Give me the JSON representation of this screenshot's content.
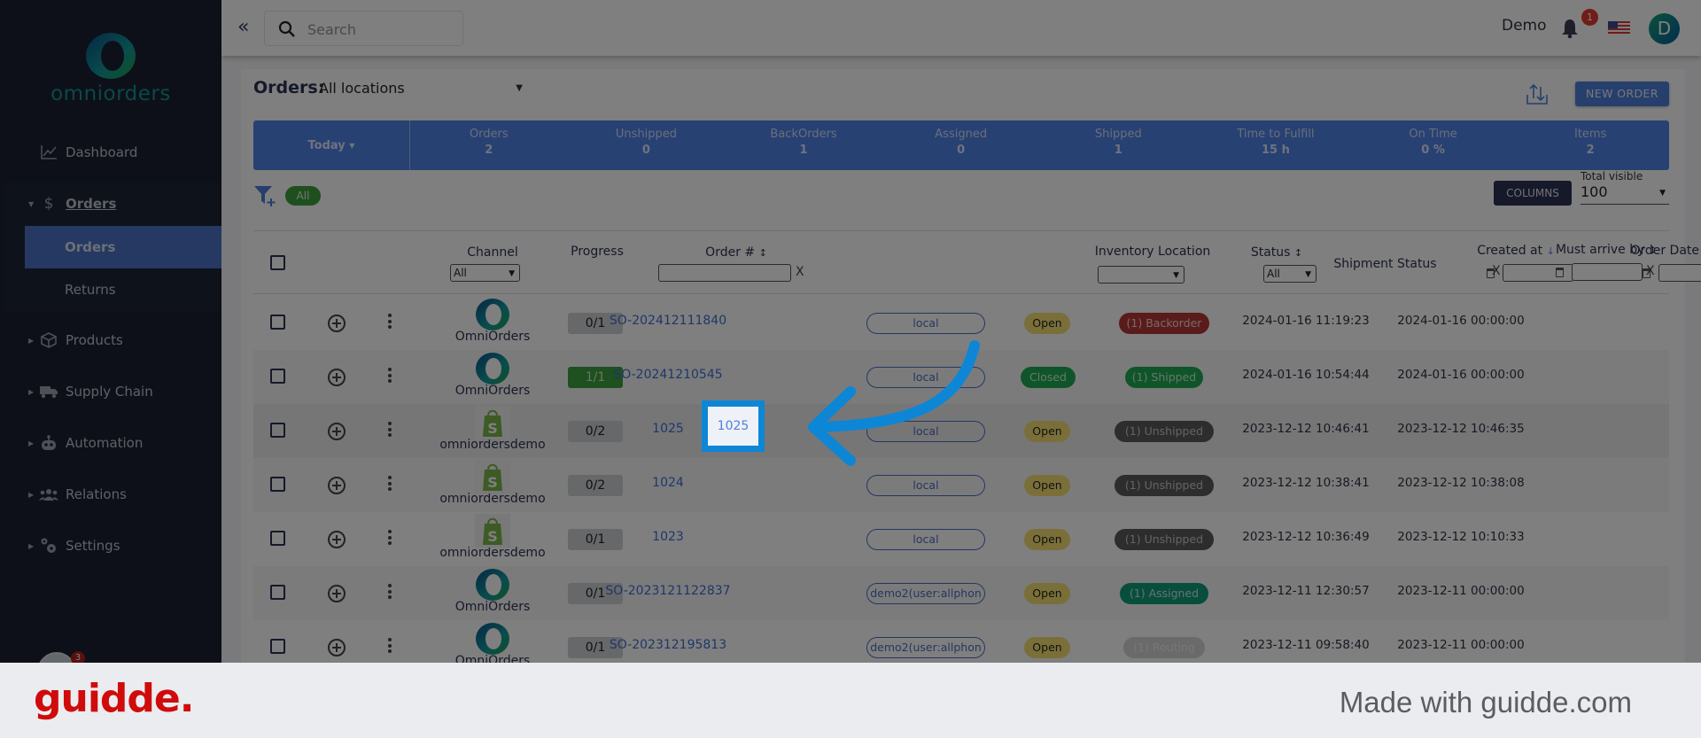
{
  "brand": {
    "name": "omniorders"
  },
  "sidebar": {
    "items": [
      {
        "label": "Dashboard",
        "icon": "chart-line-icon"
      },
      {
        "label": "Orders",
        "icon": "dollar-icon",
        "expanded": true,
        "children": [
          {
            "label": "Orders",
            "active": true
          },
          {
            "label": "Returns"
          }
        ]
      },
      {
        "label": "Products",
        "icon": "box-icon"
      },
      {
        "label": "Supply Chain",
        "icon": "truck-icon"
      },
      {
        "label": "Automation",
        "icon": "robot-icon"
      },
      {
        "label": "Relations",
        "icon": "users-icon"
      },
      {
        "label": "Settings",
        "icon": "gears-icon"
      }
    ],
    "avatar_badge": "3"
  },
  "topbar": {
    "search_placeholder": "Search",
    "user_name": "Demo",
    "notification_count": "1",
    "avatar_initial": "D"
  },
  "page": {
    "title": "Orders:",
    "location": "All locations",
    "new_order_label": "NEW ORDER"
  },
  "stats": {
    "period": "Today",
    "items": [
      {
        "label": "Orders",
        "value": "2"
      },
      {
        "label": "Unshipped",
        "value": "0"
      },
      {
        "label": "BackOrders",
        "value": "1"
      },
      {
        "label": "Assigned",
        "value": "0"
      },
      {
        "label": "Shipped",
        "value": "1"
      },
      {
        "label": "Time to Fulfill",
        "value": "15 h"
      },
      {
        "label": "On Time",
        "value": "0 %"
      },
      {
        "label": "Items",
        "value": "2"
      }
    ]
  },
  "filters": {
    "chip": "All",
    "columns_label": "COLUMNS",
    "total_visible_label": "Total visible",
    "total_visible_value": "100"
  },
  "table": {
    "headers": {
      "channel": "Channel",
      "channel_filter": "All",
      "progress": "Progress",
      "order_no": "Order #",
      "inventory_location": "Inventory Location",
      "status": "Status",
      "status_filter": "All",
      "shipment_status": "Shipment Status",
      "created_at": "Created at",
      "order_date": "Order Date",
      "must_arrive_by": "Must arrive by",
      "clear": "X"
    },
    "rows": [
      {
        "channel": "OmniOrders",
        "channel_type": "omni",
        "progress": "0/1",
        "progress_done": false,
        "order": "SO-202412111840",
        "location": "local",
        "status": "Open",
        "shipment": "(1) Backorder",
        "shipment_type": "backorder",
        "created": "2024-01-16 11:19:23",
        "order_date": "2024-01-16 00:00:00"
      },
      {
        "channel": "OmniOrders",
        "channel_type": "omni",
        "progress": "1/1",
        "progress_done": true,
        "order": "SO-20241210545",
        "location": "local",
        "status": "Closed",
        "shipment": "(1) Shipped",
        "shipment_type": "shipped",
        "created": "2024-01-16 10:54:44",
        "order_date": "2024-01-16 00:00:00"
      },
      {
        "channel": "omniordersdemo",
        "channel_type": "shopify",
        "progress": "0/2",
        "progress_done": false,
        "order": "1025",
        "location": "local",
        "status": "Open",
        "shipment": "(1) Unshipped",
        "shipment_type": "unshipped",
        "created": "2023-12-12 10:46:41",
        "order_date": "2023-12-12 10:46:35"
      },
      {
        "channel": "omniordersdemo",
        "channel_type": "shopify",
        "progress": "0/2",
        "progress_done": false,
        "order": "1024",
        "location": "local",
        "status": "Open",
        "shipment": "(1) Unshipped",
        "shipment_type": "unshipped",
        "created": "2023-12-12 10:38:41",
        "order_date": "2023-12-12 10:38:08"
      },
      {
        "channel": "omniordersdemo",
        "channel_type": "shopify",
        "progress": "0/1",
        "progress_done": false,
        "order": "1023",
        "location": "local",
        "status": "Open",
        "shipment": "(1) Unshipped",
        "shipment_type": "unshipped",
        "created": "2023-12-12 10:36:49",
        "order_date": "2023-12-12 10:10:33"
      },
      {
        "channel": "OmniOrders",
        "channel_type": "omni",
        "progress": "0/1",
        "progress_done": false,
        "order": "SO-2023121122837",
        "location": "demo2(user:allphon",
        "status": "Open",
        "shipment": "(1) Assigned",
        "shipment_type": "assigned",
        "created": "2023-12-11 12:30:57",
        "order_date": "2023-12-11 00:00:00"
      },
      {
        "channel": "OmniOrders",
        "channel_type": "omni",
        "progress": "0/1",
        "progress_done": false,
        "order": "SO-202312195813",
        "location": "demo2(user:allphon",
        "status": "Open",
        "shipment": "(1) Routing",
        "shipment_type": "routing",
        "created": "2023-12-11 09:58:40",
        "order_date": "2023-12-11 00:00:00"
      }
    ]
  },
  "highlight": {
    "order": "1025"
  },
  "footer": {
    "brand": "guidde.",
    "tagline": "Made with guidde.com"
  },
  "colors": {
    "accent": "#5083e6",
    "highlight": "#0d86d6",
    "guidde_red": "#d00b0b"
  }
}
